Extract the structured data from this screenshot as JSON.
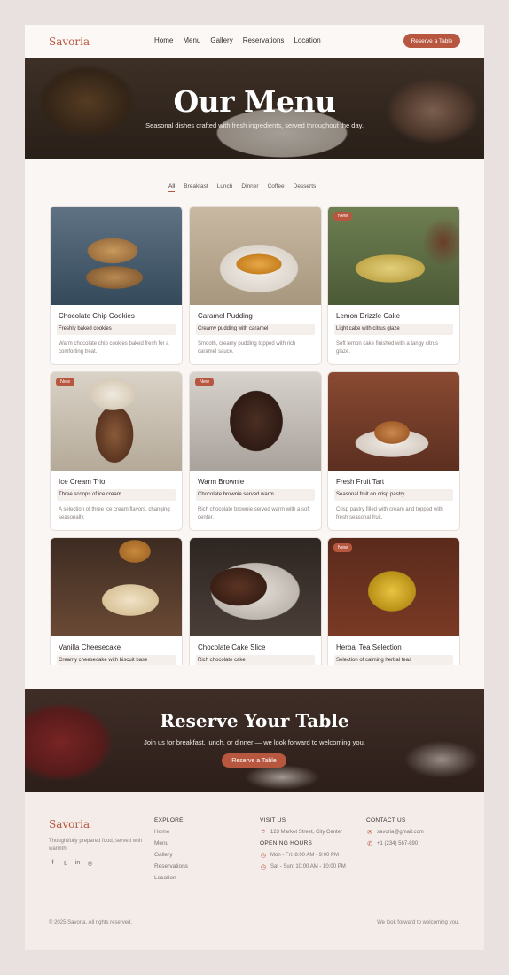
{
  "header": {
    "logo": "Savoria",
    "nav": [
      "Home",
      "Menu",
      "Gallery",
      "Reservations",
      "Location"
    ],
    "cta": "Reserve a Table"
  },
  "hero": {
    "title": "Our Menu",
    "subtitle": "Seasonal dishes crafted with fresh ingredients, served throughout the day."
  },
  "filters": [
    "All",
    "Breakfast",
    "Lunch",
    "Dinner",
    "Coffee",
    "Desserts"
  ],
  "active_filter": "All",
  "menu_items": [
    {
      "title": "Chocolate Chip Cookies",
      "tag": "Freshly baked cookies",
      "desc": "Warm chocolate chip cookies baked fresh for a comforting treat.",
      "badge": ""
    },
    {
      "title": "Caramel Pudding",
      "tag": "Creamy pudding with caramel",
      "desc": "Smooth, creamy pudding topped with rich caramel sauce.",
      "badge": ""
    },
    {
      "title": "Lemon Drizzle Cake",
      "tag": "Light cake with citrus glaze",
      "desc": "Soft lemon cake finished with a tangy citrus glaze.",
      "badge": "New"
    },
    {
      "title": "Ice Cream Trio",
      "tag": "Three scoops of ice cream",
      "desc": "A selection of three ice cream flavors, changing seasonally.",
      "badge": "New"
    },
    {
      "title": "Warm Brownie",
      "tag": "Chocolate brownie served warm",
      "desc": "Rich chocolate brownie served warm with a soft center.",
      "badge": "New"
    },
    {
      "title": "Fresh Fruit Tart",
      "tag": "Seasonal fruit on crisp pastry",
      "desc": "Crisp pastry filled with cream and topped with fresh seasonal fruit.",
      "badge": ""
    },
    {
      "title": "Vanilla Cheesecake",
      "tag": "Creamy cheesecake with biscuit base",
      "desc": "",
      "badge": ""
    },
    {
      "title": "Chocolate Cake Slice",
      "tag": "Rich chocolate cake",
      "desc": "",
      "badge": ""
    },
    {
      "title": "Herbal Tea Selection",
      "tag": "Selection of calming herbal teas",
      "desc": "",
      "badge": "New"
    }
  ],
  "reserve": {
    "title": "Reserve Your Table",
    "subtitle": "Join us for breakfast, lunch, or dinner — we look forward to welcoming you.",
    "button": "Reserve a Table"
  },
  "footer": {
    "logo": "Savoria",
    "tagline": "Thoughtfully prepared food, served with warmth.",
    "explore_heading": "EXPLORE",
    "explore_links": [
      "Home",
      "Menu",
      "Gallery",
      "Reservations",
      "Location"
    ],
    "visit_heading": "VISIT US",
    "address": "123 Market Street, City Center",
    "hours_heading": "OPENING HOURS",
    "hours": [
      "Mon - Fri: 8:00 AM - 9:00 PM",
      "Sat - Sun: 10:00 AM - 10:00 PM"
    ],
    "contact_heading": "CONTACT US",
    "email": "savoria@gmail.com",
    "phone": "+1 (234) 567-890",
    "copyright": "© 2025 Savoria. All rights reserved.",
    "closing": "We look forward to welcoming you."
  },
  "colors": {
    "accent": "#b8573f",
    "background": "#faf6f3",
    "outer": "#e9e1df"
  }
}
